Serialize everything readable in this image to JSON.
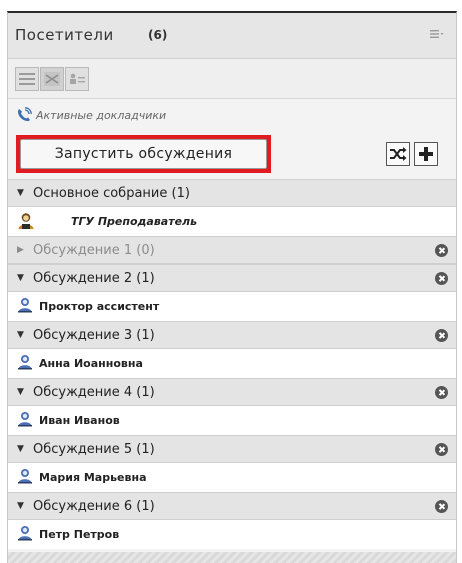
{
  "panel": {
    "title": "Посетители",
    "count": "(6)",
    "menu_icon": "menu-lines-icon"
  },
  "view_buttons": [
    {
      "name": "list-view-icon",
      "active": false
    },
    {
      "name": "breakout-view-icon",
      "active": true
    },
    {
      "name": "role-view-icon",
      "active": false
    }
  ],
  "active_speakers": {
    "label": "Активные докладчики",
    "icon": "phone-icon"
  },
  "start_button": {
    "label": "Запустить обсуждения"
  },
  "actions": {
    "shuffle_icon": "shuffle-icon",
    "add_icon": "plus-icon"
  },
  "groups": [
    {
      "label": "Основное собрание (1)",
      "expanded": true,
      "closable": false,
      "dim": false,
      "members": [
        {
          "name": "ТГУ Преподаватель",
          "role": "host"
        }
      ]
    },
    {
      "label": "Обсуждение 1 (0)",
      "expanded": false,
      "closable": true,
      "dim": true,
      "members": []
    },
    {
      "label": "Обсуждение 2 (1)",
      "expanded": true,
      "closable": true,
      "dim": false,
      "members": [
        {
          "name": "Проктор ассистент",
          "role": "participant"
        }
      ]
    },
    {
      "label": "Обсуждение 3 (1)",
      "expanded": true,
      "closable": true,
      "dim": false,
      "members": [
        {
          "name": "Анна Иоанновна",
          "role": "participant"
        }
      ]
    },
    {
      "label": "Обсуждение 4 (1)",
      "expanded": true,
      "closable": true,
      "dim": false,
      "members": [
        {
          "name": "Иван Иванов",
          "role": "participant"
        }
      ]
    },
    {
      "label": "Обсуждение 5 (1)",
      "expanded": true,
      "closable": true,
      "dim": false,
      "members": [
        {
          "name": "Мария Марьевна",
          "role": "participant"
        }
      ]
    },
    {
      "label": "Обсуждение 6 (1)",
      "expanded": true,
      "closable": true,
      "dim": false,
      "members": [
        {
          "name": "Петр Петров",
          "role": "participant"
        }
      ]
    }
  ],
  "colors": {
    "highlight": "#e11b22",
    "user_icon": "#4a6fb5",
    "host_icon": "#c8891e"
  }
}
